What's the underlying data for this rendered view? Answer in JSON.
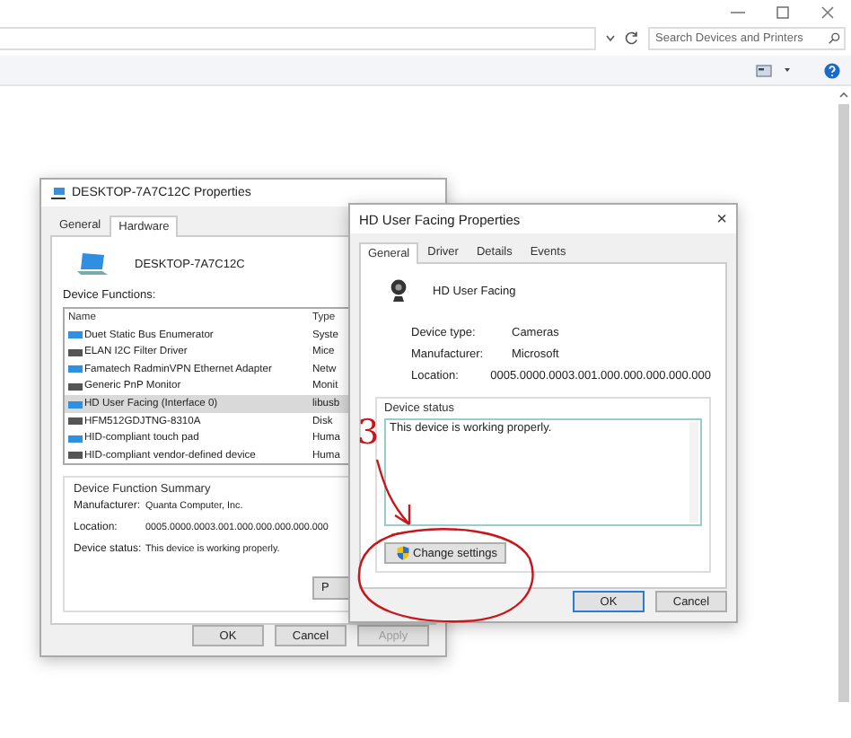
{
  "explorer": {
    "search": {
      "placeholder": "Search Devices and Printers"
    }
  },
  "computer_dialog": {
    "title": "DESKTOP-7A7C12C Properties",
    "tabs": [
      {
        "label": "General",
        "selected": false
      },
      {
        "label": "Hardware",
        "selected": true
      }
    ],
    "computer_name": "DESKTOP-7A7C12C",
    "functions_label": "Device Functions:",
    "columns": [
      "Name",
      "Type"
    ],
    "rows": [
      {
        "name": "Duet Static Bus Enumerator",
        "type": "Syste",
        "selected": false
      },
      {
        "name": "ELAN I2C Filter Driver",
        "type": "Mice",
        "selected": false
      },
      {
        "name": "Famatech RadminVPN Ethernet Adapter",
        "type": "Netw",
        "selected": false
      },
      {
        "name": "Generic PnP Monitor",
        "type": "Monit",
        "selected": false
      },
      {
        "name": "HD User Facing (Interface 0)",
        "type": "libusb",
        "selected": true
      },
      {
        "name": "HFM512GDJTNG-8310A",
        "type": "Disk",
        "selected": false
      },
      {
        "name": "HID-compliant touch pad",
        "type": "Huma",
        "selected": false
      },
      {
        "name": "HID-compliant vendor-defined device",
        "type": "Huma",
        "selected": false
      }
    ],
    "summary": {
      "title": "Device Function Summary",
      "fields": [
        {
          "label": "Manufacturer:",
          "value": "Quanta Computer, Inc."
        },
        {
          "label": "Location:",
          "value": "0005.0000.0003.001.000.000.000.000.000"
        },
        {
          "label": "Device status:",
          "value": "This device is working properly."
        }
      ]
    },
    "properties_button": "P",
    "buttons": [
      {
        "label": "OK",
        "disabled": false
      },
      {
        "label": "Cancel",
        "disabled": false
      },
      {
        "label": "Apply",
        "disabled": true
      }
    ]
  },
  "camera_dialog": {
    "title": "HD User Facing Properties",
    "close": "×",
    "tabs": [
      {
        "label": "General",
        "selected": true
      },
      {
        "label": "Driver",
        "selected": false
      },
      {
        "label": "Details",
        "selected": false
      },
      {
        "label": "Events",
        "selected": false
      }
    ],
    "device_name": "HD User Facing",
    "fields": [
      {
        "label": "Device type:",
        "value": "Cameras"
      },
      {
        "label": "Manufacturer:",
        "value": "Microsoft"
      },
      {
        "label": "Location:",
        "value": "0005.0000.0003.001.000.000.000.000.000"
      }
    ],
    "status_title": "Device status",
    "status_text": "This device is working properly.",
    "change_button": "Change settings",
    "buttons": [
      {
        "label": "OK",
        "default": true
      },
      {
        "label": "Cancel",
        "default": false
      }
    ]
  },
  "annotation": {
    "label": "3"
  }
}
